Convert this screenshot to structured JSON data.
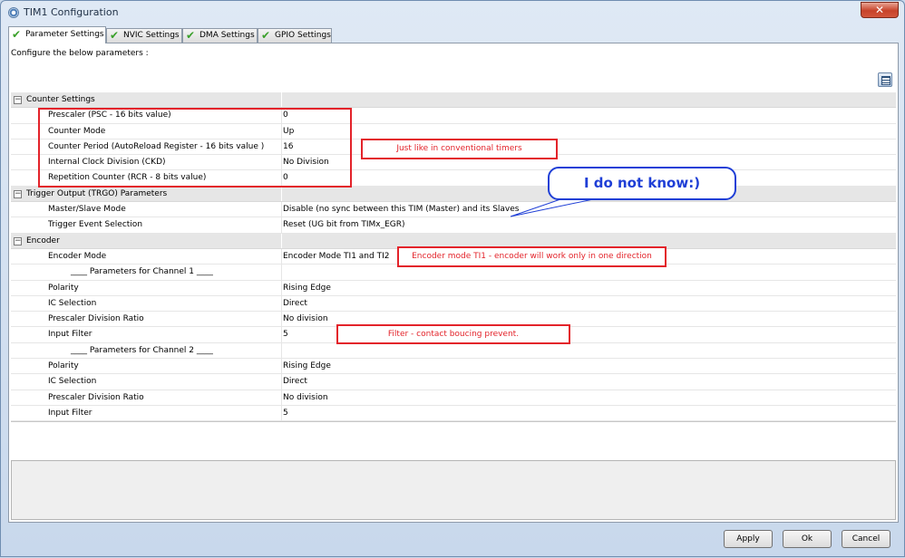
{
  "window": {
    "title": "TIM1 Configuration",
    "close_symbol": "✕"
  },
  "tabs": [
    {
      "label": "Parameter Settings",
      "active": true
    },
    {
      "label": "NVIC Settings",
      "active": false
    },
    {
      "label": "DMA Settings",
      "active": false
    },
    {
      "label": "GPIO Settings",
      "active": false
    }
  ],
  "panel": {
    "intro": "Configure the below parameters :"
  },
  "groups": {
    "counter": {
      "title": "Counter Settings",
      "rows": [
        {
          "name": "Prescaler (PSC - 16 bits value)",
          "value": "0"
        },
        {
          "name": "Counter Mode",
          "value": "Up"
        },
        {
          "name": "Counter Period (AutoReload Register - 16 bits value )",
          "value": "16"
        },
        {
          "name": "Internal Clock Division (CKD)",
          "value": "No Division"
        },
        {
          "name": "Repetition Counter (RCR - 8 bits value)",
          "value": "0"
        }
      ]
    },
    "trgo": {
      "title": "Trigger Output (TRGO) Parameters",
      "rows": [
        {
          "name": "Master/Slave Mode",
          "value": "Disable (no sync between this TIM (Master) and its Slaves"
        },
        {
          "name": "Trigger Event Selection",
          "value": "Reset (UG bit from TIMx_EGR)"
        }
      ]
    },
    "encoder": {
      "title": "Encoder",
      "rows": [
        {
          "name": "Encoder Mode",
          "value": "Encoder Mode TI1 and TI2"
        },
        {
          "name": "____ Parameters for Channel 1 ____",
          "value": ""
        },
        {
          "name": "Polarity",
          "value": "Rising Edge"
        },
        {
          "name": "IC Selection",
          "value": "Direct"
        },
        {
          "name": "Prescaler Division Ratio",
          "value": "No division"
        },
        {
          "name": "Input Filter",
          "value": "5"
        },
        {
          "name": "____ Parameters for Channel 2 ____",
          "value": ""
        },
        {
          "name": "Polarity",
          "value": "Rising Edge"
        },
        {
          "name": "IC Selection",
          "value": "Direct"
        },
        {
          "name": "Prescaler Division Ratio",
          "value": "No division"
        },
        {
          "name": "Input Filter",
          "value": "5"
        }
      ]
    }
  },
  "annotations": {
    "timers_note": "Just like in conventional timers",
    "callout": "I do not know:)",
    "encoder_note": "Encoder mode TI1 - encoder will work only in one direction",
    "filter_note": "Filter - contact boucing prevent."
  },
  "buttons": {
    "apply": "Apply",
    "ok": "Ok",
    "cancel": "Cancel"
  },
  "colors": {
    "annotation_red": "#e3232a",
    "callout_blue": "#1f3fd6",
    "check_green": "#3aa02a"
  }
}
